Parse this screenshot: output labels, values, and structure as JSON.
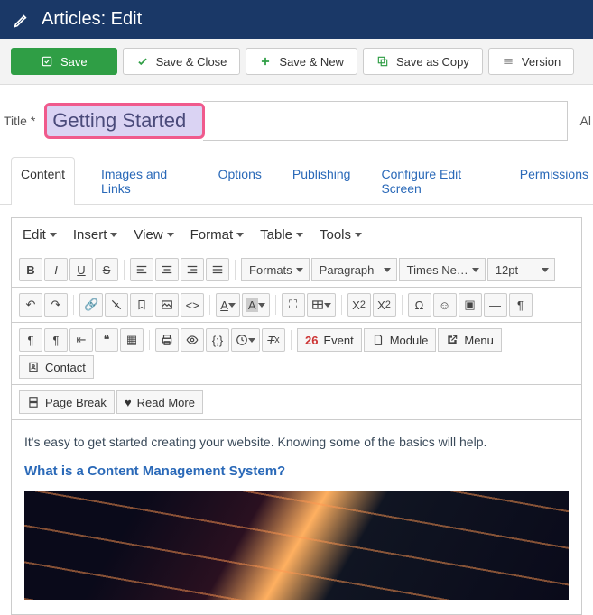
{
  "header": {
    "title": "Articles: Edit"
  },
  "toolbar": {
    "save": "Save",
    "save_close": "Save & Close",
    "save_new": "Save & New",
    "save_copy": "Save as Copy",
    "versions": "Version"
  },
  "title_field": {
    "label": "Title *",
    "value": "Getting Started",
    "alias_label": "Al"
  },
  "tabs": [
    "Content",
    "Images and Links",
    "Options",
    "Publishing",
    "Configure Edit Screen",
    "Permissions"
  ],
  "editor": {
    "menus": [
      "Edit",
      "Insert",
      "View",
      "Format",
      "Table",
      "Tools"
    ],
    "formats_label": "Formats",
    "block_label": "Paragraph",
    "font_label": "Times Ne…",
    "size_label": "12pt",
    "btn_event": "Event",
    "btn_module": "Module",
    "btn_menu": "Menu",
    "btn_contact": "Contact",
    "btn_pagebreak": "Page Break",
    "btn_readmore": "Read More"
  },
  "content": {
    "intro": "It's easy to get started creating your website. Knowing some of the basics will help.",
    "h3": "What is a Content Management System?"
  }
}
